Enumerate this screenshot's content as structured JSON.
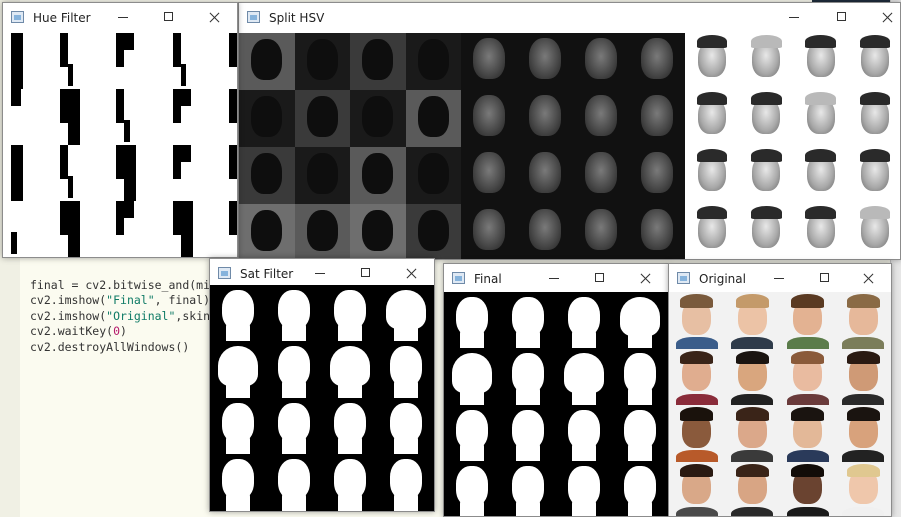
{
  "editor": {
    "code_lines": [
      {
        "pre": "final = cv2.bitwise_and(mi",
        "str": "",
        "post": ""
      },
      {
        "pre": "cv2.imshow(",
        "str": "\"Final\"",
        "post": ", final)"
      },
      {
        "pre": "cv2.imshow(",
        "str": "\"Original\"",
        "post": ",skin"
      },
      {
        "pre": "cv2.waitKey(",
        "str": "",
        "num": "0",
        "post": ")"
      },
      {
        "pre": "cv2.destroyAllWindows()",
        "str": "",
        "post": ""
      }
    ]
  },
  "windows": {
    "hue": {
      "title": "Hue Filter"
    },
    "split": {
      "title": "Split HSV"
    },
    "sat": {
      "title": "Sat Filter"
    },
    "final": {
      "title": "Final"
    },
    "original": {
      "title": "Original"
    }
  },
  "colors": {
    "window_bg": "#ffffff",
    "mask_black": "#000000",
    "mask_white": "#ffffff",
    "editor_bg": "#fbfbf0",
    "string_color": "#0f7b66",
    "number_color": "#b5186b"
  },
  "icons": {
    "app": "app-window-icon",
    "minimize": "minimize-icon",
    "maximize": "maximize-icon",
    "close": "close-icon"
  }
}
